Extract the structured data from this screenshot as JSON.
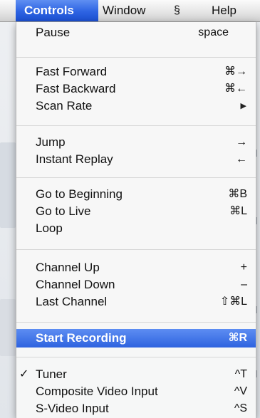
{
  "menubar": {
    "items": [
      {
        "label": "Controls",
        "selected": true
      },
      {
        "label": "Window",
        "selected": false
      },
      {
        "icon": "script-icon"
      },
      {
        "label": "Help",
        "selected": false
      }
    ]
  },
  "menu": {
    "items": [
      {
        "label": "Pause",
        "shortcut": "space"
      },
      {
        "label": "Fast Forward",
        "shortcut": "⌘→"
      },
      {
        "label": "Fast Backward",
        "shortcut": "⌘←"
      },
      {
        "label": "Scan Rate",
        "submenu": true
      },
      {
        "label": "Jump",
        "shortcut": "→"
      },
      {
        "label": "Instant Replay",
        "shortcut": "←"
      },
      {
        "label": "Go to Beginning",
        "shortcut": "⌘B"
      },
      {
        "label": "Go to Live",
        "shortcut": "⌘L"
      },
      {
        "label": "Loop",
        "shortcut": ""
      },
      {
        "label": "Channel Up",
        "shortcut": "+"
      },
      {
        "label": "Channel Down",
        "shortcut": "–"
      },
      {
        "label": "Last Channel",
        "shortcut": "⇧⌘L"
      },
      {
        "label": "Start Recording",
        "shortcut": "⌘R",
        "highlighted": true
      },
      {
        "label": "Tuner",
        "shortcut": "^T",
        "checked": true
      },
      {
        "label": "Composite Video Input",
        "shortcut": "^V"
      },
      {
        "label": "S-Video Input",
        "shortcut": "^S"
      }
    ]
  },
  "colors": {
    "selection": "#2d63e2",
    "menu_bg": "#f7f7f7"
  }
}
